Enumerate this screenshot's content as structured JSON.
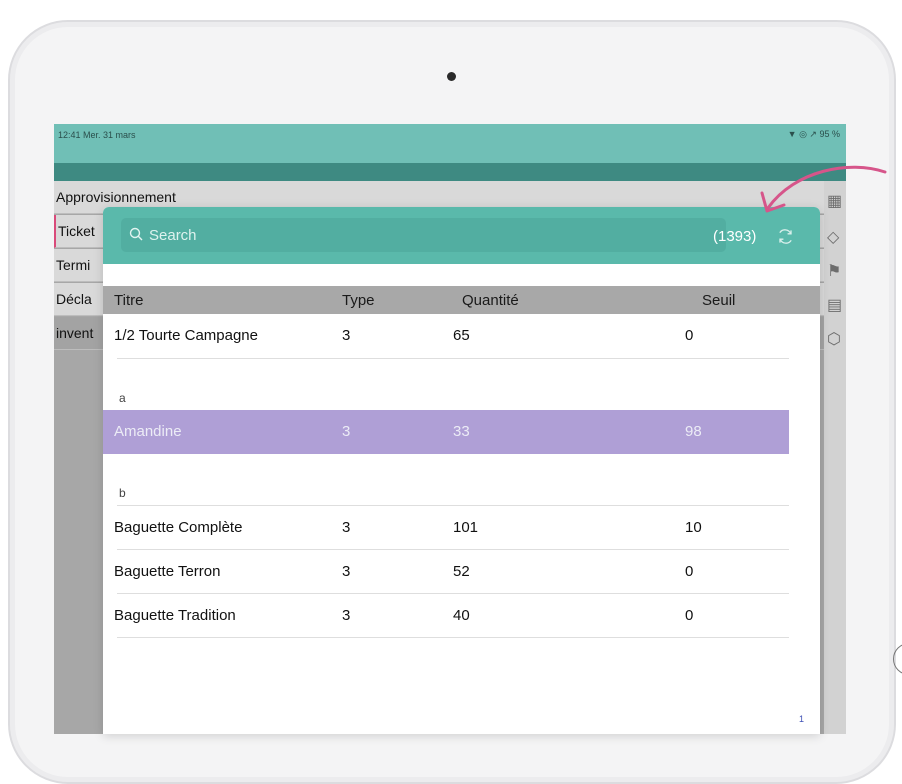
{
  "status_bar": {
    "time_date": "12:41  Mer. 31 mars",
    "indicators": "▼ ◎ ↗ 95 %"
  },
  "background_list": {
    "items": [
      "Approvisionnement",
      "Ticket",
      "Termi",
      "Décla",
      "invent"
    ]
  },
  "modal": {
    "search": {
      "placeholder": "Search",
      "value": ""
    },
    "count": "(1393)",
    "refresh_icon": "refresh-icon",
    "columns": [
      "Titre",
      "Type",
      "Quantité",
      "Seuil"
    ],
    "rows": [
      {
        "titre": "1/2 Tourte Campagne",
        "type": "3",
        "quantite": "65",
        "seuil": "0"
      }
    ],
    "sections": [
      {
        "letter": "a",
        "rows": [
          {
            "titre": "Amandine",
            "type": "3",
            "quantite": "33",
            "seuil": "98",
            "selected": true
          }
        ]
      },
      {
        "letter": "b",
        "rows": [
          {
            "titre": "Baguette Complète",
            "type": "3",
            "quantite": "101",
            "seuil": "10"
          },
          {
            "titre": "Baguette Terron",
            "type": "3",
            "quantite": "52",
            "seuil": "0"
          },
          {
            "titre": "Baguette Tradition",
            "type": "3",
            "quantite": "40",
            "seuil": "0"
          }
        ]
      }
    ],
    "page_number": "1"
  },
  "colors": {
    "header_teal": "#5ab9ab",
    "status_teal": "#70bfb6",
    "selected_row": "#af9fd6",
    "annotation_arrow": "#d6558a"
  }
}
